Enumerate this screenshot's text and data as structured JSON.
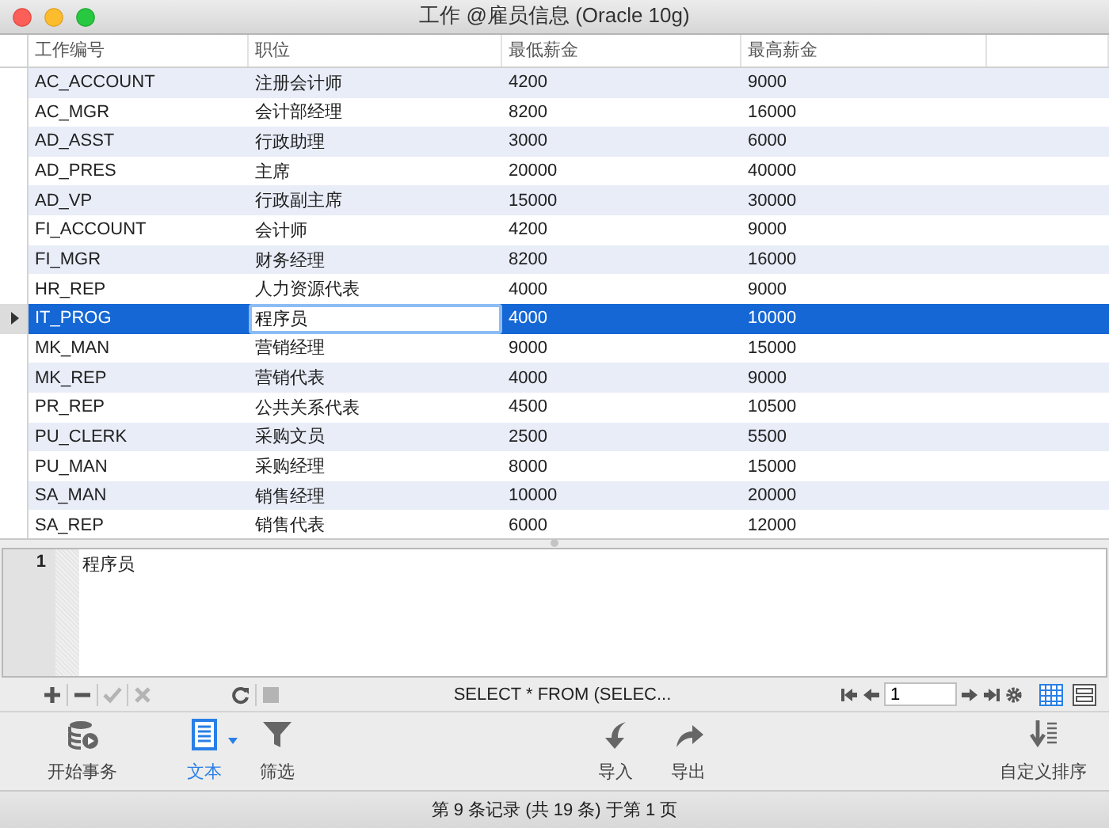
{
  "window": {
    "title": "工作 @雇员信息 (Oracle 10g)"
  },
  "table": {
    "columns": [
      {
        "label": "工作编号",
        "editing": false
      },
      {
        "label": "职位",
        "editing": true
      },
      {
        "label": "最低薪金",
        "editing": false
      },
      {
        "label": "最高薪金",
        "editing": false
      }
    ],
    "rows": [
      {
        "cells": [
          "AC_ACCOUNT",
          "注册会计师",
          "4200",
          "9000"
        ],
        "selected": false
      },
      {
        "cells": [
          "AC_MGR",
          "会计部经理",
          "8200",
          "16000"
        ],
        "selected": false
      },
      {
        "cells": [
          "AD_ASST",
          "行政助理",
          "3000",
          "6000"
        ],
        "selected": false
      },
      {
        "cells": [
          "AD_PRES",
          "主席",
          "20000",
          "40000"
        ],
        "selected": false
      },
      {
        "cells": [
          "AD_VP",
          "行政副主席",
          "15000",
          "30000"
        ],
        "selected": false
      },
      {
        "cells": [
          "FI_ACCOUNT",
          "会计师",
          "4200",
          "9000"
        ],
        "selected": false
      },
      {
        "cells": [
          "FI_MGR",
          "财务经理",
          "8200",
          "16000"
        ],
        "selected": false
      },
      {
        "cells": [
          "HR_REP",
          "人力资源代表",
          "4000",
          "9000"
        ],
        "selected": false
      },
      {
        "cells": [
          "IT_PROG",
          "程序员",
          "4000",
          "10000"
        ],
        "selected": true
      },
      {
        "cells": [
          "MK_MAN",
          "营销经理",
          "9000",
          "15000"
        ],
        "selected": false
      },
      {
        "cells": [
          "MK_REP",
          "营销代表",
          "4000",
          "9000"
        ],
        "selected": false
      },
      {
        "cells": [
          "PR_REP",
          "公共关系代表",
          "4500",
          "10500"
        ],
        "selected": false
      },
      {
        "cells": [
          "PU_CLERK",
          "采购文员",
          "2500",
          "5500"
        ],
        "selected": false
      },
      {
        "cells": [
          "PU_MAN",
          "采购经理",
          "8000",
          "15000"
        ],
        "selected": false
      },
      {
        "cells": [
          "SA_MAN",
          "销售经理",
          "10000",
          "20000"
        ],
        "selected": false
      },
      {
        "cells": [
          "SA_REP",
          "销售代表",
          "6000",
          "12000"
        ],
        "selected": false
      }
    ]
  },
  "editor": {
    "lines": [
      {
        "number": "1",
        "text": "程序员"
      }
    ]
  },
  "record_toolbar": {
    "buttons": [
      {
        "kind": "add",
        "disabled": false
      },
      {
        "kind": "remove",
        "disabled": false
      },
      {
        "kind": "apply",
        "disabled": true
      },
      {
        "kind": "discard",
        "disabled": true
      },
      {
        "kind": "refresh",
        "disabled": false
      },
      {
        "kind": "stop",
        "disabled": true
      }
    ],
    "sql": "SELECT * FROM (SELEC...",
    "page": "1",
    "views": [
      {
        "kind": "grid",
        "selected": true
      },
      {
        "kind": "form",
        "selected": false
      }
    ]
  },
  "main_toolbar": {
    "items": [
      {
        "kind": "transaction",
        "label": "开始事务",
        "selected": false
      },
      {
        "kind": "text",
        "label": "文本",
        "selected": true
      },
      {
        "kind": "filter",
        "label": "筛选",
        "selected": false
      },
      {
        "kind": "import",
        "label": "导入",
        "selected": false
      },
      {
        "kind": "export",
        "label": "导出",
        "selected": false
      },
      {
        "kind": "sort",
        "label": "自定义排序",
        "selected": false
      }
    ]
  },
  "status_bar": {
    "text": "第 9 条记录 (共 19 条) 于第 1 页"
  }
}
